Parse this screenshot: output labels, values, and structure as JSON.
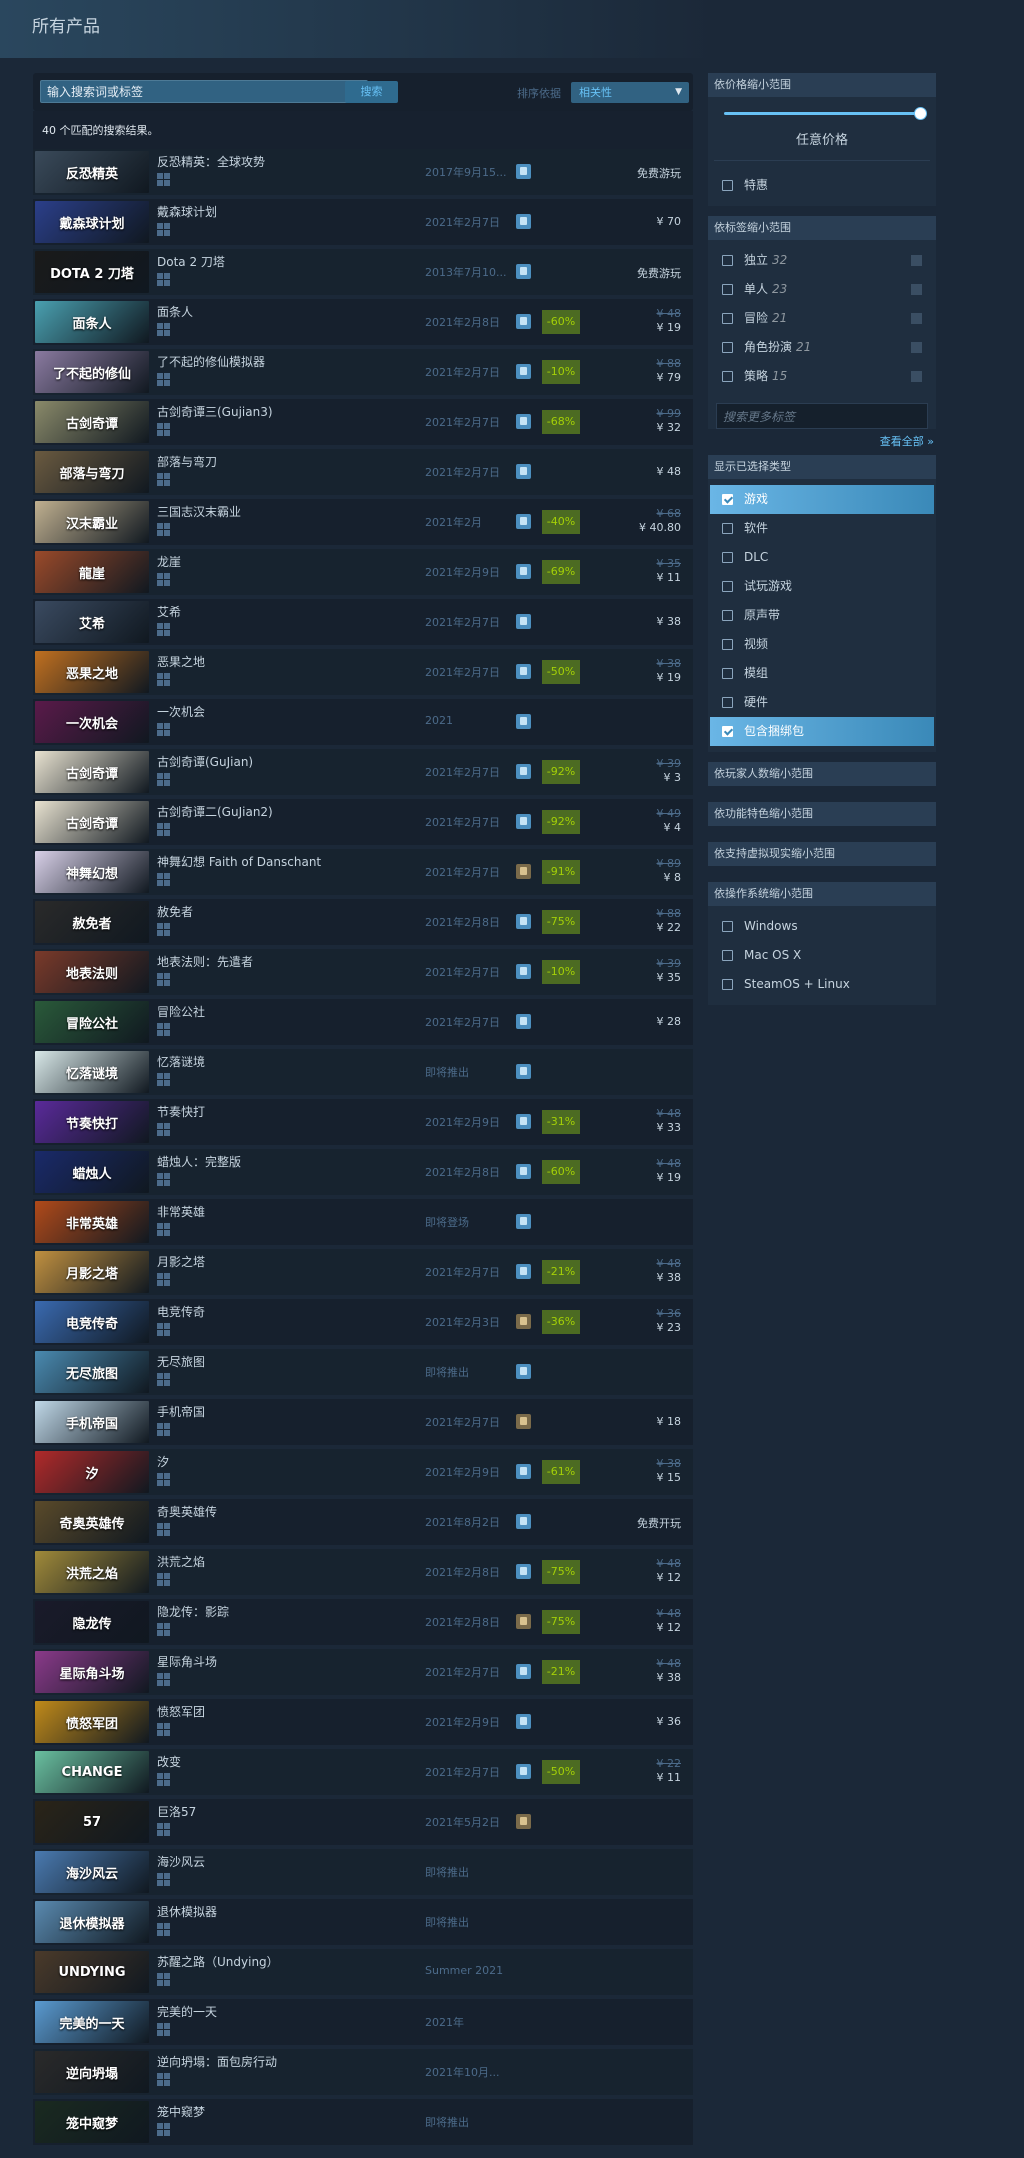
{
  "page_title": "所有产品",
  "search": {
    "placeholder": "输入搜索词或标签",
    "button": "搜索",
    "sort_label": "排序依据",
    "sort_value": "相关性"
  },
  "result_count": "40 个匹配的搜索结果。",
  "colors": {
    "accent": "#67c1f5",
    "background": "#1b2838",
    "discount_bg": "#4c6b22",
    "discount_text": "#a4d007"
  },
  "rows": [
    {
      "name": "反恐精英：全球攻势",
      "date": "2017年9月15...",
      "review": "positive",
      "discount": "",
      "orig": "",
      "price": "免费游玩",
      "cap_text": "反恐精英",
      "cap_color": "#3a4a5a"
    },
    {
      "name": "戴森球计划",
      "date": "2021年2月7日",
      "review": "positive",
      "discount": "",
      "orig": "",
      "price": "¥ 70",
      "cap_text": "戴森球计划",
      "cap_color": "#2b3f8a"
    },
    {
      "name": "Dota 2 刀塔",
      "date": "2013年7月10...",
      "review": "positive",
      "discount": "",
      "orig": "",
      "price": "免费游玩",
      "cap_text": "DOTA 2 刀塔",
      "cap_color": "#1a1a1a"
    },
    {
      "name": "面条人",
      "date": "2021年2月8日",
      "review": "positive",
      "discount": "-60%",
      "orig": "¥ 48",
      "price": "¥ 19",
      "cap_text": "面条人",
      "cap_color": "#4aa0b0"
    },
    {
      "name": "了不起的修仙模拟器",
      "date": "2021年2月7日",
      "review": "positive",
      "discount": "-10%",
      "orig": "¥ 88",
      "price": "¥ 79",
      "cap_text": "了不起的修仙",
      "cap_color": "#8a7aa0"
    },
    {
      "name": "古剑奇谭三(Gujian3)",
      "date": "2021年2月7日",
      "review": "positive",
      "discount": "-68%",
      "orig": "¥ 99",
      "price": "¥ 32",
      "cap_text": "古剑奇谭",
      "cap_color": "#8a8a6a"
    },
    {
      "name": "部落与弯刀",
      "date": "2021年2月7日",
      "review": "positive",
      "discount": "",
      "orig": "",
      "price": "¥ 48",
      "cap_text": "部落与弯刀",
      "cap_color": "#6a5a40"
    },
    {
      "name": "三国志汉末霸业",
      "date": "2021年2月",
      "review": "positive",
      "discount": "-40%",
      "orig": "¥ 68",
      "price": "¥ 40.80",
      "cap_text": "汉末霸业",
      "cap_color": "#c0b090"
    },
    {
      "name": "龙崖",
      "date": "2021年2月9日",
      "review": "positive",
      "discount": "-69%",
      "orig": "¥ 35",
      "price": "¥ 11",
      "cap_text": "龍崖",
      "cap_color": "#9a4a2a"
    },
    {
      "name": "艾希",
      "date": "2021年2月7日",
      "review": "positive",
      "discount": "",
      "orig": "",
      "price": "¥ 38",
      "cap_text": "艾希",
      "cap_color": "#3a4a60"
    },
    {
      "name": "恶果之地",
      "date": "2021年2月7日",
      "review": "positive",
      "discount": "-50%",
      "orig": "¥ 38",
      "price": "¥ 19",
      "cap_text": "恶果之地",
      "cap_color": "#c07020"
    },
    {
      "name": "一次机会",
      "date": "2021",
      "review": "positive",
      "discount": "",
      "orig": "",
      "price": "",
      "cap_text": "一次机会",
      "cap_color": "#5a1a4a"
    },
    {
      "name": "古剑奇谭(GuJian)",
      "date": "2021年2月7日",
      "review": "positive",
      "discount": "-92%",
      "orig": "¥ 39",
      "price": "¥ 3",
      "cap_text": "古剑奇谭",
      "cap_color": "#e8e2d0"
    },
    {
      "name": "古剑奇谭二(GuJian2)",
      "date": "2021年2月7日",
      "review": "positive",
      "discount": "-92%",
      "orig": "¥ 49",
      "price": "¥ 4",
      "cap_text": "古剑奇谭",
      "cap_color": "#e8e2d0"
    },
    {
      "name": "神舞幻想 Faith of Danschant",
      "date": "2021年2月7日",
      "review": "mixed",
      "discount": "-91%",
      "orig": "¥ 89",
      "price": "¥ 8",
      "cap_text": "神舞幻想",
      "cap_color": "#d8d0e8"
    },
    {
      "name": "赦免者",
      "date": "2021年2月8日",
      "review": "positive",
      "discount": "-75%",
      "orig": "¥ 88",
      "price": "¥ 22",
      "cap_text": "赦免者",
      "cap_color": "#2a2a2a"
    },
    {
      "name": "地表法则：先遣者",
      "date": "2021年2月7日",
      "review": "positive",
      "discount": "-10%",
      "orig": "¥ 39",
      "price": "¥ 35",
      "cap_text": "地表法则",
      "cap_color": "#7a3a2a"
    },
    {
      "name": "冒险公社",
      "date": "2021年2月7日",
      "review": "positive",
      "discount": "",
      "orig": "",
      "price": "¥ 28",
      "cap_text": "冒险公社",
      "cap_color": "#2a5a3a"
    },
    {
      "name": "忆落谜境",
      "date": "即将推出",
      "review": "positive",
      "discount": "",
      "orig": "",
      "price": "",
      "cap_text": "忆落谜境",
      "cap_color": "#d8e8e8"
    },
    {
      "name": "节奏快打",
      "date": "2021年2月9日",
      "review": "positive",
      "discount": "-31%",
      "orig": "¥ 48",
      "price": "¥ 33",
      "cap_text": "节奏快打",
      "cap_color": "#5a2a9a"
    },
    {
      "name": "蜡烛人：完整版",
      "date": "2021年2月8日",
      "review": "positive",
      "discount": "-60%",
      "orig": "¥ 48",
      "price": "¥ 19",
      "cap_text": "蜡烛人",
      "cap_color": "#1a2a6a"
    },
    {
      "name": "非常英雄",
      "date": "即将登场",
      "review": "positive",
      "discount": "",
      "orig": "",
      "price": "",
      "cap_text": "非常英雄",
      "cap_color": "#b04a1a"
    },
    {
      "name": "月影之塔",
      "date": "2021年2月7日",
      "review": "positive",
      "discount": "-21%",
      "orig": "¥ 48",
      "price": "¥ 38",
      "cap_text": "月影之塔",
      "cap_color": "#c09040"
    },
    {
      "name": "电竞传奇",
      "date": "2021年2月3日",
      "review": "mixed",
      "discount": "-36%",
      "orig": "¥ 36",
      "price": "¥ 23",
      "cap_text": "电竞传奇",
      "cap_color": "#3a6ab0"
    },
    {
      "name": "无尽旅图",
      "date": "即将推出",
      "review": "positive",
      "discount": "",
      "orig": "",
      "price": "",
      "cap_text": "无尽旅图",
      "cap_color": "#4a8ab0"
    },
    {
      "name": "手机帝国",
      "date": "2021年2月7日",
      "review": "mixed",
      "discount": "",
      "orig": "",
      "price": "¥ 18",
      "cap_text": "手机帝国",
      "cap_color": "#c0d8e8"
    },
    {
      "name": "汐",
      "date": "2021年2月9日",
      "review": "positive",
      "discount": "-61%",
      "orig": "¥ 38",
      "price": "¥ 15",
      "cap_text": "汐",
      "cap_color": "#b02a2a"
    },
    {
      "name": "奇奥英雄传",
      "date": "2021年8月2日",
      "review": "positive",
      "discount": "",
      "orig": "",
      "price": "免费开玩",
      "cap_text": "奇奥英雄传",
      "cap_color": "#5a4a2a"
    },
    {
      "name": "洪荒之焰",
      "date": "2021年2月8日",
      "review": "positive",
      "discount": "-75%",
      "orig": "¥ 48",
      "price": "¥ 12",
      "cap_text": "洪荒之焰",
      "cap_color": "#a08a3a"
    },
    {
      "name": "隐龙传：影踪",
      "date": "2021年2月8日",
      "review": "mixed",
      "discount": "-75%",
      "orig": "¥ 48",
      "price": "¥ 12",
      "cap_text": "隐龙传",
      "cap_color": "#1a1a2a"
    },
    {
      "name": "星际角斗场",
      "date": "2021年2月7日",
      "review": "positive",
      "discount": "-21%",
      "orig": "¥ 48",
      "price": "¥ 38",
      "cap_text": "星际角斗场",
      "cap_color": "#8a3a8a"
    },
    {
      "name": "愤怒军团",
      "date": "2021年2月9日",
      "review": "positive",
      "discount": "",
      "orig": "",
      "price": "¥ 36",
      "cap_text": "愤怒军团",
      "cap_color": "#c08a1a"
    },
    {
      "name": "改变",
      "date": "2021年2月7日",
      "review": "positive",
      "discount": "-50%",
      "orig": "¥ 22",
      "price": "¥ 11",
      "cap_text": "CHANGE",
      "cap_color": "#6ac0a0"
    },
    {
      "name": "巨洛57",
      "date": "2021年5月2日",
      "review": "mixed",
      "discount": "",
      "orig": "",
      "price": "",
      "cap_text": "57",
      "cap_color": "#2a2418"
    },
    {
      "name": "海沙风云",
      "date": "即将推出",
      "review": "none",
      "discount": "",
      "orig": "",
      "price": "",
      "cap_text": "海沙风云",
      "cap_color": "#4a7ab0"
    },
    {
      "name": "退休模拟器",
      "date": "即将推出",
      "review": "none",
      "discount": "",
      "orig": "",
      "price": "",
      "cap_text": "退休模拟器",
      "cap_color": "#5a8ab0"
    },
    {
      "name": "苏醒之路（Undying）",
      "date": "Summer 2021",
      "review": "none",
      "discount": "",
      "orig": "",
      "price": "",
      "cap_text": "UNDYING",
      "cap_color": "#4a3a2a"
    },
    {
      "name": "完美的一天",
      "date": "2021年",
      "review": "none",
      "discount": "",
      "orig": "",
      "price": "",
      "cap_text": "完美的一天",
      "cap_color": "#5a9ad0"
    },
    {
      "name": "逆向坍塌：面包房行动",
      "date": "2021年10月...",
      "review": "none",
      "discount": "",
      "orig": "",
      "price": "",
      "cap_text": "逆向坍塌",
      "cap_color": "#2a2a2a"
    },
    {
      "name": "笼中窥梦",
      "date": "即将推出",
      "review": "none",
      "discount": "",
      "orig": "",
      "price": "",
      "cap_text": "笼中窥梦",
      "cap_color": "#1a2a20"
    }
  ],
  "sidebar": {
    "price": {
      "title": "依价格缩小范围",
      "label": "任意价格",
      "slider_value": 1.0,
      "special": "特惠"
    },
    "tags": {
      "title": "依标签缩小范围",
      "items": [
        {
          "label": "独立",
          "count": "32"
        },
        {
          "label": "单人",
          "count": "23"
        },
        {
          "label": "冒险",
          "count": "21"
        },
        {
          "label": "角色扮演",
          "count": "21"
        },
        {
          "label": "策略",
          "count": "15"
        }
      ],
      "search_placeholder": "搜索更多标签",
      "see_all": "查看全部"
    },
    "types": {
      "title": "显示已选择类型",
      "items": [
        {
          "label": "游戏",
          "checked": true
        },
        {
          "label": "软件",
          "checked": false
        },
        {
          "label": "DLC",
          "checked": false
        },
        {
          "label": "试玩游戏",
          "checked": false
        },
        {
          "label": "原声带",
          "checked": false
        },
        {
          "label": "视频",
          "checked": false
        },
        {
          "label": "模组",
          "checked": false
        },
        {
          "label": "硬件",
          "checked": false
        },
        {
          "label": "包含捆绑包",
          "checked": true
        }
      ]
    },
    "players": "依玩家人数缩小范围",
    "features": "依功能特色缩小范围",
    "vr": "依支持虚拟现实缩小范围",
    "os": {
      "title": "依操作系统缩小范围",
      "items": [
        "Windows",
        "Mac OS X",
        "SteamOS + Linux"
      ]
    }
  }
}
